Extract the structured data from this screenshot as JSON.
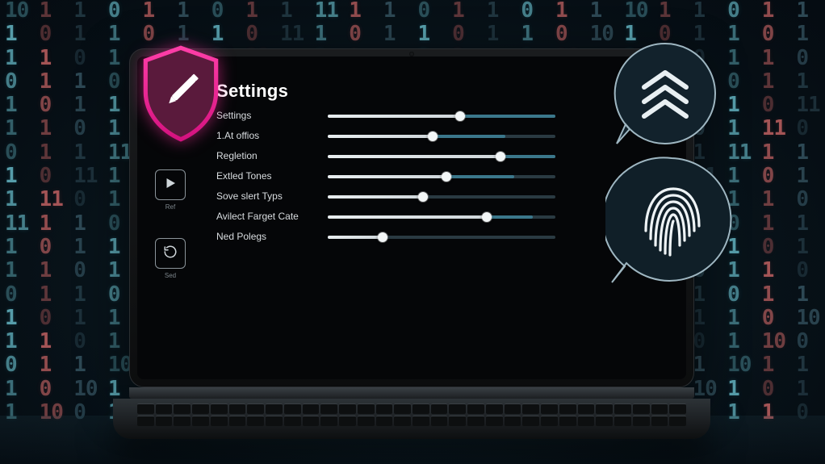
{
  "page_title": "Settings",
  "colors": {
    "accent_magenta": "#e11f8f",
    "shield_fill": "#6b1b45",
    "bubble_fill": "#13232e",
    "slider_fill": "#e8edef",
    "slider_tail": "#3d7e93"
  },
  "sidebar": {
    "items": [
      {
        "icon": "play-icon",
        "caption": "Ref"
      },
      {
        "icon": "refresh-icon",
        "caption": "Sed"
      }
    ]
  },
  "settings": [
    {
      "label": "Settings",
      "value": 58,
      "tail_to": 100
    },
    {
      "label": "1.At offios",
      "value": 46,
      "tail_to": 78
    },
    {
      "label": "Regletion",
      "value": 76,
      "tail_to": 100
    },
    {
      "label": "Extled Tones",
      "value": 52,
      "tail_to": 82
    },
    {
      "label": "Sove slert Typs",
      "value": 42,
      "tail_to": 42
    },
    {
      "label": "Avilect Farget Cate",
      "value": 70,
      "tail_to": 90
    },
    {
      "label": "Ned Polegs",
      "value": 24,
      "tail_to": 24
    }
  ],
  "badges": {
    "shield": {
      "name": "security-shield",
      "icon": "pencil-icon"
    },
    "chevrons": {
      "name": "rank-bubble",
      "icon": "chevrons-up-icon"
    },
    "fingerprint": {
      "name": "biometric-bubble",
      "icon": "fingerprint-icon"
    }
  }
}
